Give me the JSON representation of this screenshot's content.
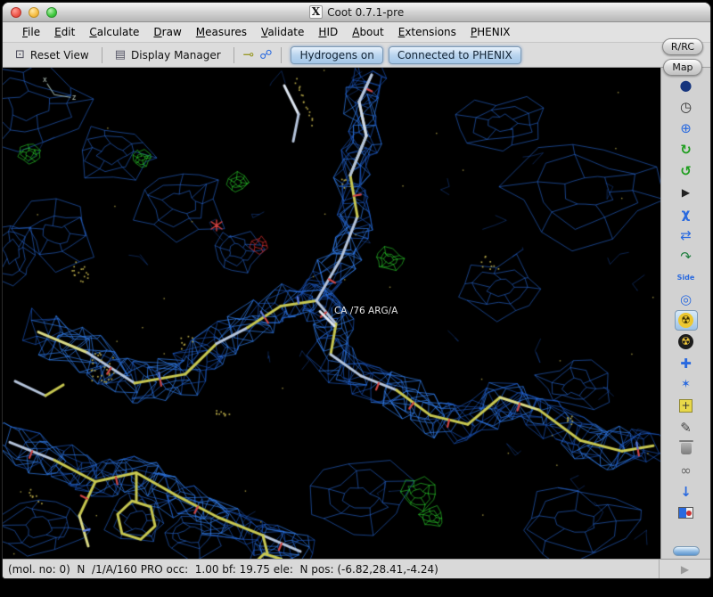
{
  "window": {
    "title": "Coot 0.7.1-pre"
  },
  "menu": {
    "items": [
      "File",
      "Edit",
      "Calculate",
      "Draw",
      "Measures",
      "Validate",
      "HID",
      "About",
      "Extensions",
      "PHENIX"
    ]
  },
  "side_buttons": {
    "rrc": "R/RC",
    "map": "Map"
  },
  "toolbar": {
    "reset_view": "Reset View",
    "display_manager": "Display Manager",
    "hydrogens_button": "Hydrogens on",
    "phenix_button": "Connected to PHENIX"
  },
  "canvas": {
    "residue_label": "CA /76 ARG/A"
  },
  "statusbar": {
    "text": "(mol. no: 0)  N  /1/A/160 PRO occ:  1.00 bf: 19.75 ele:  N pos: (-6.82,28.41,-4.24)"
  },
  "colors": {
    "density_mesh": "#2b6cdc",
    "difference_positive": "#28be28",
    "difference_negative": "#d72d2d",
    "carbon_sticks": "#c7c750",
    "selected_tool_bg": "#9cc2e6"
  },
  "icons": {
    "x11": "X",
    "reset_view": "⊡",
    "display_manager": "▤",
    "key": "⊸",
    "goto": "☍",
    "sphere": "●",
    "clock": "◷",
    "translate": "⊕",
    "rotate": "↻",
    "torsion": "↺",
    "play": "▶",
    "chi": "χ",
    "swap": "⇄",
    "curve": "↷",
    "side": "Side",
    "target": "◎",
    "radiation": "☢",
    "cross": "✚",
    "spark": "✶",
    "plus": "+",
    "pencil": "✎",
    "rings": "∞",
    "down": "↓",
    "triangle": "▶"
  }
}
